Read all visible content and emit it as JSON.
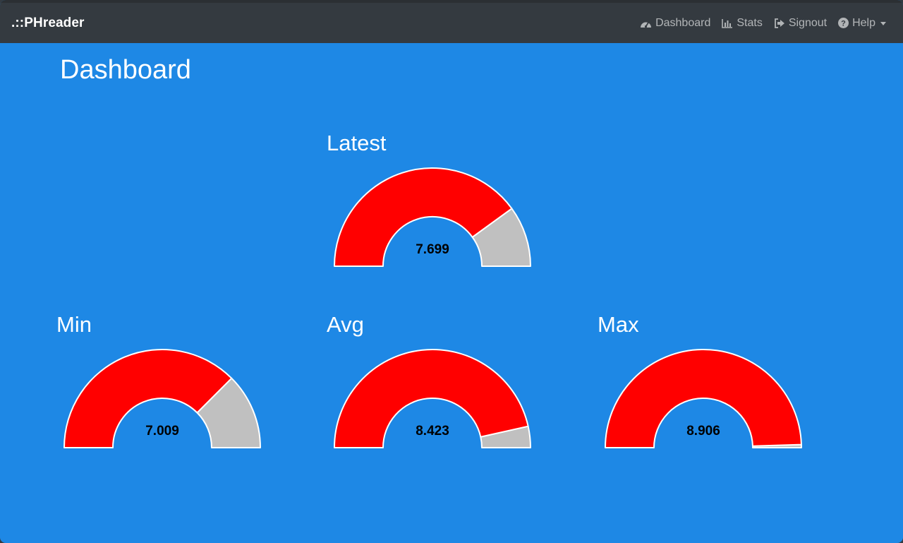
{
  "app": {
    "brand": ".::PHreader"
  },
  "nav": {
    "items": [
      {
        "label": "Dashboard",
        "icon": "dashboard-icon"
      },
      {
        "label": "Stats",
        "icon": "bar-chart-icon"
      },
      {
        "label": "Signout",
        "icon": "signout-icon"
      },
      {
        "label": "Help",
        "icon": "question-circle-icon",
        "dropdown": true
      }
    ]
  },
  "page": {
    "title": "Dashboard"
  },
  "colors": {
    "filled": "#ff0000",
    "remaining": "#c0c0c0",
    "background": "#1e88e5",
    "navbar": "#343a40"
  },
  "gauges": {
    "latest": {
      "title": "Latest",
      "value": "7.699",
      "fraction": 0.8
    },
    "min": {
      "title": "Min",
      "value": "7.009",
      "fraction": 0.75
    },
    "avg": {
      "title": "Avg",
      "value": "8.423",
      "fraction": 0.93
    },
    "max": {
      "title": "Max",
      "value": "8.906",
      "fraction": 0.99
    }
  }
}
